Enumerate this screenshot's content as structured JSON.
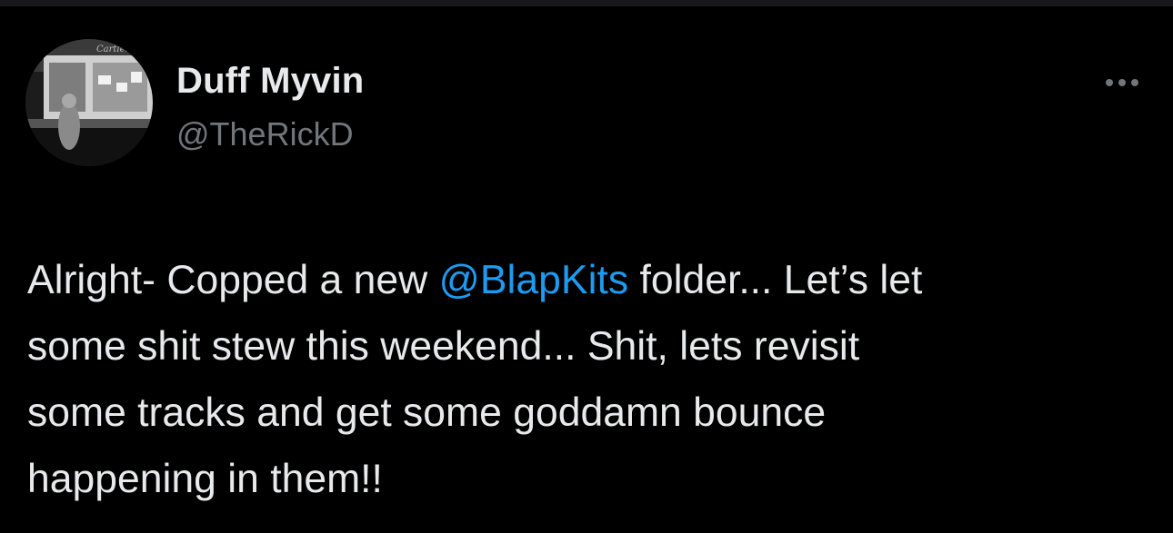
{
  "colors": {
    "background": "#000000",
    "text": "#e7e9ea",
    "secondary": "#71767b",
    "mention": "#1d9bf0"
  },
  "author": {
    "name": "Duff Myvin",
    "handle": "@TheRickD",
    "avatar_icon": "profile-photo"
  },
  "tweet": {
    "lines": [
      {
        "pre": "Alright- Copped a new ",
        "mention": "@BlapKits",
        "post": " folder... Let’s let"
      },
      {
        "pre": "some shit stew this weekend... Shit, lets revisit",
        "mention": "",
        "post": ""
      },
      {
        "pre": "some tracks and get some goddamn bounce",
        "mention": "",
        "post": ""
      },
      {
        "pre": "happening in them!!",
        "mention": "",
        "post": ""
      }
    ]
  },
  "more_icon": "more-horizontal-icon"
}
